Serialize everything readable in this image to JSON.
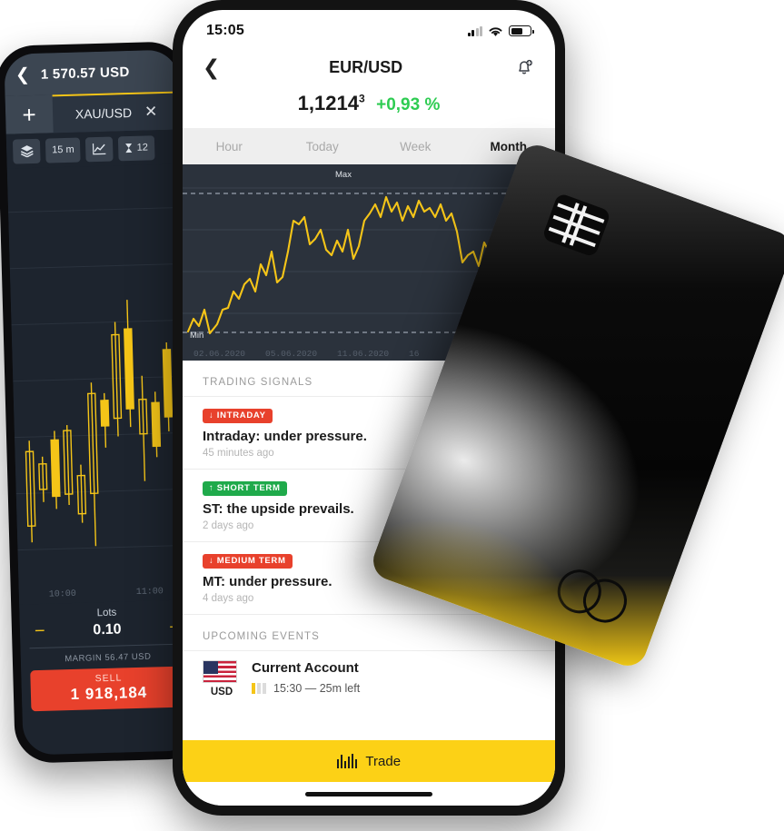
{
  "dark_phone": {
    "header": {
      "back_icon": "chevron-left-icon",
      "balance": "1 570.57 USD"
    },
    "tabs": {
      "add_icon": "plus-icon",
      "active_tab": "XAU/USD",
      "close_icon": "close-icon"
    },
    "toolbar": [
      {
        "name": "layers-icon",
        "label": ""
      },
      {
        "name": "timeframe",
        "label": "15 m"
      },
      {
        "name": "line-chart-icon",
        "label": ""
      },
      {
        "name": "hourglass-count",
        "label": "12"
      }
    ],
    "chart": {
      "type": "candlestick",
      "color": "#f5c518",
      "time_labels": [
        "10:00",
        "11:00"
      ]
    },
    "order": {
      "lots_label": "Lots",
      "lots_value": "0.10",
      "minus": "−",
      "plus": "+",
      "margin": "MARGIN 56.47 USD",
      "sell_label": "SELL",
      "sell_price": "1 918,184"
    }
  },
  "light_phone": {
    "status": {
      "time": "15:05",
      "signal_icon": "cellular-signal-icon",
      "wifi_icon": "wifi-icon",
      "battery_icon": "battery-icon"
    },
    "nav": {
      "back_icon": "chevron-left-icon",
      "title": "EUR/USD",
      "bell_icon": "bell-add-icon"
    },
    "quote": {
      "price": "1,1214",
      "price_sup": "3",
      "change": "+0,93 %",
      "change_color": "#2ecc52"
    },
    "tabs": [
      {
        "label": "Hour",
        "active": false
      },
      {
        "label": "Today",
        "active": false
      },
      {
        "label": "Week",
        "active": false
      },
      {
        "label": "Month",
        "active": true
      }
    ],
    "chart": {
      "max_label": "Max",
      "min_label": "Min",
      "dates": [
        "02.06.2020",
        "05.06.2020",
        "11.06.2020",
        "16"
      ]
    },
    "signals_title": "TRADING SIGNALS",
    "signals": [
      {
        "badge": "↓ INTRADAY",
        "badge_type": "down",
        "text": "Intraday: under pressure.",
        "time": "45 minutes ago"
      },
      {
        "badge": "↑ SHORT TERM",
        "badge_type": "up",
        "text": "ST: the upside prevails.",
        "time": "2 days ago"
      },
      {
        "badge": "↓ MEDIUM TERM",
        "badge_type": "down",
        "text": "MT: under pressure.",
        "time": "4 days ago"
      }
    ],
    "events_title": "UPCOMING EVENTS",
    "event": {
      "currency": "USD",
      "flag_icon": "us-flag-icon",
      "name": "Current Account",
      "impact_filled": 1,
      "impact_total": 3,
      "time": "15:30 — 25m left"
    },
    "trade": {
      "icon": "candlestick-icon",
      "label": "Trade"
    }
  },
  "card": {
    "chip_icon": "emv-chip-icon",
    "logo_icon": "two-circles-logo-icon",
    "accent": "#fcd116"
  },
  "chart_data": {
    "type": "line",
    "title": "EUR/USD Month",
    "xlabel": "",
    "ylabel": "",
    "x": [
      "02.06.2020",
      "05.06.2020",
      "11.06.2020",
      "16.06.2020"
    ],
    "annotations": [
      "Max",
      "Min"
    ],
    "values": [
      1.1108,
      1.1122,
      1.1101,
      1.1135,
      1.1118,
      1.111,
      1.1131,
      1.116,
      1.1152,
      1.1178,
      1.1171,
      1.1196,
      1.1188,
      1.1214,
      1.1205,
      1.124,
      1.1232,
      1.1258,
      1.129,
      1.1282,
      1.1305,
      1.1296,
      1.1288,
      1.131,
      1.1301,
      1.1326,
      1.1318,
      1.1342,
      1.1358,
      1.1349,
      1.1372,
      1.1364,
      1.134,
      1.1352,
      1.1328,
      1.1316,
      1.1334,
      1.131,
      1.1295,
      1.1288
    ],
    "ylim": [
      1.1095,
      1.138
    ],
    "grid": true,
    "series_color": "#f5c518"
  }
}
